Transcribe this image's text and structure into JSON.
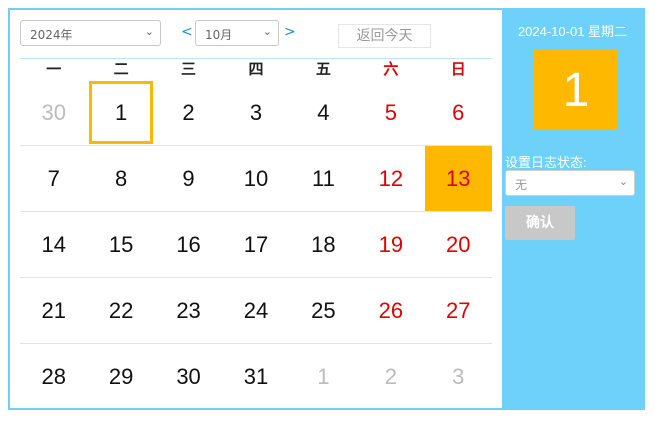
{
  "toolbar": {
    "year_value": "2024年",
    "month_value": "10月",
    "prev_symbol": "<",
    "next_symbol": ">",
    "today_label": "返回今天"
  },
  "weekdays": [
    "一",
    "二",
    "三",
    "四",
    "五",
    "六",
    "日"
  ],
  "weeks": [
    [
      {
        "d": "30",
        "t": "other"
      },
      {
        "d": "1",
        "t": "selected"
      },
      {
        "d": "2",
        "t": ""
      },
      {
        "d": "3",
        "t": ""
      },
      {
        "d": "4",
        "t": ""
      },
      {
        "d": "5",
        "t": "weekend"
      },
      {
        "d": "6",
        "t": "weekend"
      }
    ],
    [
      {
        "d": "7",
        "t": ""
      },
      {
        "d": "8",
        "t": ""
      },
      {
        "d": "9",
        "t": ""
      },
      {
        "d": "10",
        "t": ""
      },
      {
        "d": "11",
        "t": ""
      },
      {
        "d": "12",
        "t": "weekend"
      },
      {
        "d": "13",
        "t": "weekend today"
      }
    ],
    [
      {
        "d": "14",
        "t": ""
      },
      {
        "d": "15",
        "t": ""
      },
      {
        "d": "16",
        "t": ""
      },
      {
        "d": "17",
        "t": ""
      },
      {
        "d": "18",
        "t": ""
      },
      {
        "d": "19",
        "t": "weekend"
      },
      {
        "d": "20",
        "t": "weekend"
      }
    ],
    [
      {
        "d": "21",
        "t": ""
      },
      {
        "d": "22",
        "t": ""
      },
      {
        "d": "23",
        "t": ""
      },
      {
        "d": "24",
        "t": ""
      },
      {
        "d": "25",
        "t": ""
      },
      {
        "d": "26",
        "t": "weekend"
      },
      {
        "d": "27",
        "t": "weekend"
      }
    ],
    [
      {
        "d": "28",
        "t": ""
      },
      {
        "d": "29",
        "t": ""
      },
      {
        "d": "30",
        "t": ""
      },
      {
        "d": "31",
        "t": ""
      },
      {
        "d": "1",
        "t": "other"
      },
      {
        "d": "2",
        "t": "other"
      },
      {
        "d": "3",
        "t": "other"
      }
    ]
  ],
  "side": {
    "date_text": "2024-10-01 星期二",
    "big_day": "1",
    "status_label": "设置日志状态:",
    "status_value": "无",
    "confirm_label": "确认"
  },
  "colors": {
    "accent_blue": "#6dd1f9",
    "highlight_orange": "#ffb800",
    "weekend_red": "#e00000",
    "muted_gray": "#bcbcbc"
  },
  "icons": {
    "dropdown": "chevron-down-icon"
  }
}
